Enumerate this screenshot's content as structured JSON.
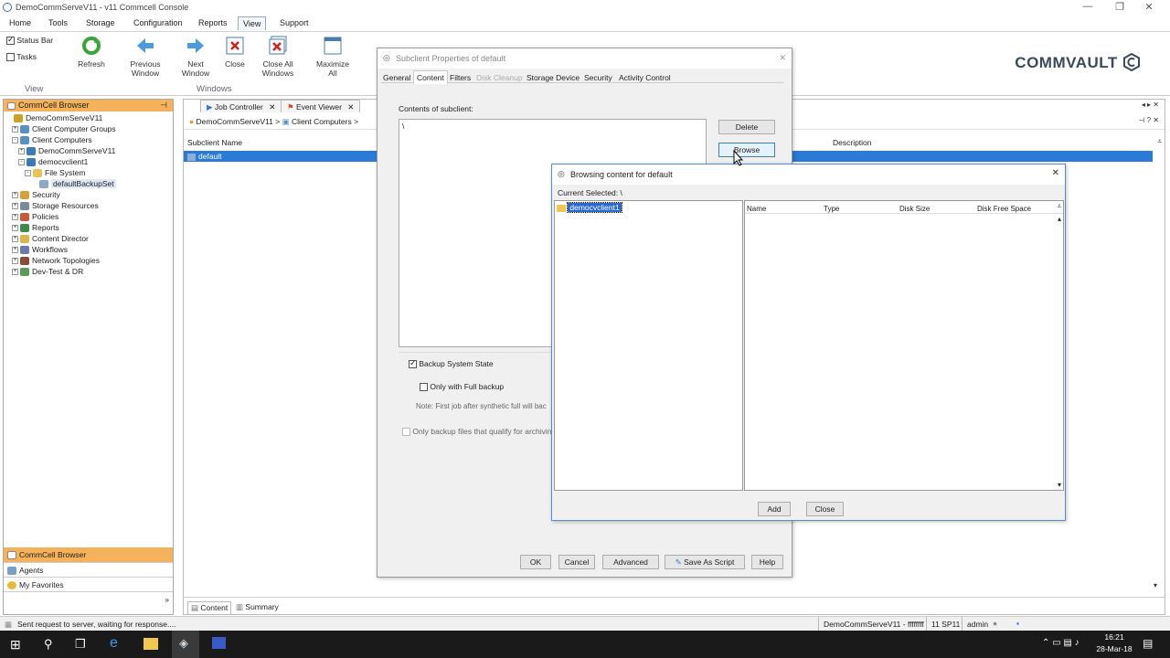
{
  "window": {
    "title": "DemoCommServeV11 - v11 Commcell Console",
    "min": "—",
    "max": "❐",
    "close": "✕"
  },
  "menu": [
    "Home",
    "Tools",
    "Storage",
    "Configuration",
    "Reports",
    "View",
    "Support"
  ],
  "ribbon": {
    "status_bar": "Status Bar",
    "tasks": "Tasks",
    "refresh": "Refresh",
    "previous_window": [
      "Previous",
      "Window"
    ],
    "next_window": [
      "Next",
      "Window"
    ],
    "close": "Close",
    "close_all": [
      "Close All",
      "Windows"
    ],
    "maximize_all": [
      "Maximize",
      "All"
    ],
    "group_view": "View",
    "group_windows": "Windows",
    "logo": "COMMVAULT"
  },
  "browser": {
    "header": "CommCell Browser",
    "tree": [
      {
        "label": "DemoCommServeV11",
        "indent": 0,
        "exp": "",
        "color": "#c9a227"
      },
      {
        "label": "Client Computer Groups",
        "indent": 1,
        "exp": "+",
        "color": "#5a8fc2"
      },
      {
        "label": "Client Computers",
        "indent": 1,
        "exp": "-",
        "color": "#5a8fc2"
      },
      {
        "label": "DemoCommServeV11",
        "indent": 2,
        "exp": "+",
        "color": "#3a7ab8"
      },
      {
        "label": "democvclient1",
        "indent": 2,
        "exp": "-",
        "color": "#3a7ab8"
      },
      {
        "label": "File System",
        "indent": 3,
        "exp": "-",
        "color": "#e8c35a"
      },
      {
        "label": "defaultBackupSet",
        "indent": 4,
        "exp": "",
        "color": "#8aa8c8"
      },
      {
        "label": "Security",
        "indent": 1,
        "exp": "+",
        "color": "#d4a23a"
      },
      {
        "label": "Storage Resources",
        "indent": 1,
        "exp": "+",
        "color": "#7a8a9a"
      },
      {
        "label": "Policies",
        "indent": 1,
        "exp": "+",
        "color": "#c85a3a"
      },
      {
        "label": "Reports",
        "indent": 1,
        "exp": "+",
        "color": "#3a8a4a"
      },
      {
        "label": "Content Director",
        "indent": 1,
        "exp": "+",
        "color": "#d8b84a"
      },
      {
        "label": "Workflows",
        "indent": 1,
        "exp": "+",
        "color": "#6a7aaa"
      },
      {
        "label": "Network Topologies",
        "indent": 1,
        "exp": "+",
        "color": "#8a4a3a"
      },
      {
        "label": "Dev-Test & DR",
        "indent": 1,
        "exp": "+",
        "color": "#5a9a5a"
      }
    ],
    "bottom_nav": [
      "CommCell Browser",
      "Agents",
      "My Favorites"
    ]
  },
  "main": {
    "tabs": [
      "Job Controller",
      "Event Viewer"
    ],
    "breadcrumb": [
      "DemoCommServeV11",
      ">",
      "Client Computers",
      ">"
    ],
    "col_subclient": "Subclient Name",
    "col_description": "Description",
    "row_default": "default",
    "bottom_tabs": [
      "Content",
      "Summary"
    ]
  },
  "subclient_dialog": {
    "title": "Subclient Properties of default",
    "tabs": [
      "General",
      "Content",
      "Filters",
      "Disk Cleanup",
      "Storage Device",
      "Security",
      "Activity Control"
    ],
    "contents_label": "Contents of subclient:",
    "content_entry": "\\",
    "delete": "Delete",
    "browse": "Browse",
    "backup_system_state": "Backup System State",
    "only_full": "Only with Full backup",
    "note": "Note: First job after synthetic full will bac",
    "only_archiving": "Only backup files that qualify for archiving",
    "ok": "OK",
    "cancel": "Cancel",
    "advanced": "Advanced",
    "save_as_script": "Save As Script",
    "help": "Help"
  },
  "browse_dialog": {
    "title": "Browsing content for default",
    "current_selected": "Current Selected: \\",
    "tree_item": "democvclient1",
    "columns": [
      "Name",
      "Type",
      "Disk Size",
      "Disk Free Space"
    ],
    "add": "Add",
    "close": "Close"
  },
  "status": {
    "message": "Sent request to server, waiting for response....",
    "server": "DemoCommServeV11 - ffffffff",
    "version": "11 SP11",
    "user": "admin"
  },
  "taskbar": {
    "time": "16:21",
    "date": "28-Mar-18"
  }
}
